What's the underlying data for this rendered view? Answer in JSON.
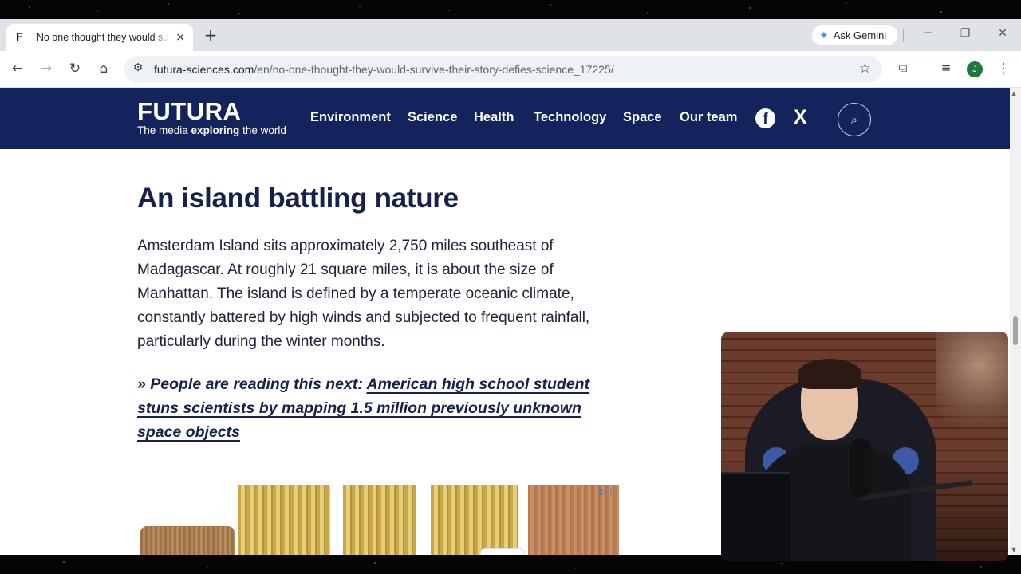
{
  "browser": {
    "tab": {
      "favicon": "F",
      "title": "No one thought they would survive their story defies science",
      "close_icon": "×"
    },
    "new_tab_icon": "+",
    "ask_gemini": "Ask Gemini",
    "window_controls": {
      "minimize": "─",
      "restore": "❐",
      "close": "✕"
    },
    "toolbar_icons": {
      "back": "←",
      "forward": "→",
      "reload": "↻",
      "home": "⌂"
    },
    "url_host": "futura-sciences.com",
    "url_path": "/en/no-one-thought-they-would-survive-their-story-defies-science_17225/",
    "bookmark_icon": "☆",
    "profile_initial": "J"
  },
  "site": {
    "logo_name": "FUTURA",
    "logo_tag_pre": "The media ",
    "logo_tag_bold": "exploring",
    "logo_tag_post": " the world",
    "nav": [
      "Environment",
      "Science",
      "Health",
      "Technology",
      "Space",
      "Our team"
    ],
    "facebook_glyph": "f",
    "x_glyph": "X",
    "brand_color": "#13245c"
  },
  "article": {
    "heading": "An island battling nature",
    "paragraph": "Amsterdam Island sits approximately 2,750 miles southeast of Madagascar. At roughly 21 square miles, it is about the size of Manhattan. The island is defined by a temperate oceanic climate, constantly battered by high winds and subjected to frequent rainfall, particularly during the winter months.",
    "read_next_prefix": "» People are reading this next: ",
    "read_next_link": "American high school student stuns scientists by mapping 1.5 million previously unknown space objects"
  },
  "ad": {
    "items": [
      "seagrass-roll",
      "bamboo-fence",
      "bamboo-fence",
      "bamboo-fence",
      "wood-fence"
    ],
    "adchoices_icon": "▷⋮"
  },
  "scroll_up_icon": "⌃"
}
